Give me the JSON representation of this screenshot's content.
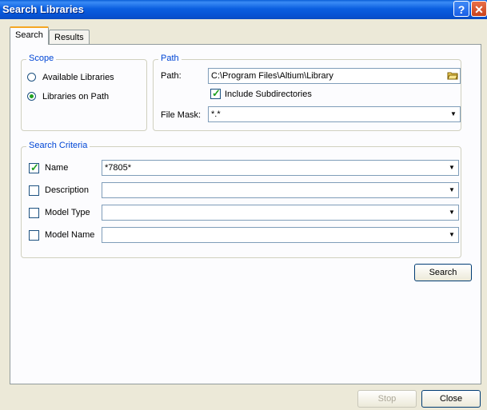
{
  "window": {
    "title": "Search Libraries",
    "help_glyph": "?",
    "close_glyph": "✕"
  },
  "tabs": [
    {
      "label": "Search",
      "active": true
    },
    {
      "label": "Results",
      "active": false
    }
  ],
  "scope": {
    "legend": "Scope",
    "options": [
      {
        "label": "Available Libraries",
        "selected": false
      },
      {
        "label": "Libraries on Path",
        "selected": true
      }
    ]
  },
  "path": {
    "legend": "Path",
    "path_label": "Path:",
    "path_value": "C:\\Program Files\\Altium\\Library",
    "include_subdirs_label": "Include Subdirectories",
    "include_subdirs_checked": true,
    "file_mask_label": "File Mask:",
    "file_mask_value": "*.*"
  },
  "criteria": {
    "legend": "Search Criteria",
    "rows": [
      {
        "label": "Name",
        "checked": true,
        "value": "*7805*"
      },
      {
        "label": "Description",
        "checked": false,
        "value": ""
      },
      {
        "label": "Model Type",
        "checked": false,
        "value": ""
      },
      {
        "label": "Model Name",
        "checked": false,
        "value": ""
      }
    ]
  },
  "buttons": {
    "search": "Search",
    "stop": "Stop",
    "close": "Close"
  },
  "icons": {
    "dropdown": "chevron-down-icon",
    "browse": "folder-icon",
    "check": "checkmark-icon"
  },
  "colors": {
    "title_bar": "#0a5fd8",
    "group_legend": "#0046d5",
    "check_tick": "#21a121",
    "active_tab_accent": "#f5a623"
  }
}
